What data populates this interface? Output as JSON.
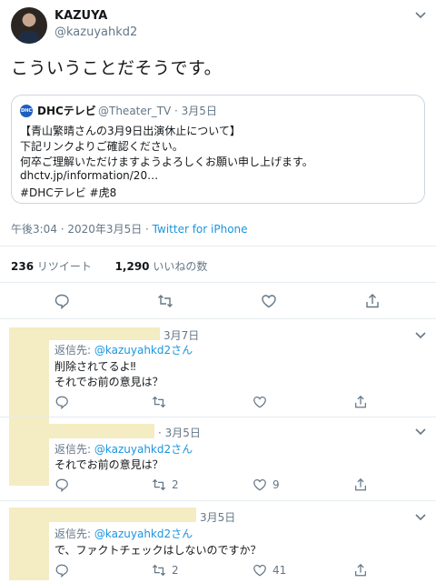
{
  "tweet": {
    "author_name": "KAZUYA",
    "author_handle": "@kazuyahkd2",
    "text": "こういうことだそうです。",
    "quoted": {
      "logo_text": "DHC",
      "name": "DHCテレビ",
      "handle_date": "@Theater_TV · 3月5日",
      "lines": [
        "【青山繁晴さんの3月9日出演休止について】",
        "下記リンクよりご確認ください。",
        "何卒ご理解いただけますようよろしくお願い申し上げます。",
        "dhctv.jp/information/20…",
        "#DHCテレビ #虎8"
      ]
    },
    "timestamp": "午後3:04 · 2020年3月5日 ·",
    "source": "Twitter for iPhone",
    "retweets_count": "236",
    "retweets_label": "リツイート",
    "likes_count": "1,290",
    "likes_label": "いいねの数"
  },
  "replies": [
    {
      "date": "3月7日",
      "reply_prefix": "返信先:",
      "reply_handle": "@kazuyahkd2さん",
      "lines": [
        "削除されてるよ‼",
        "それでお前の意見は？"
      ],
      "retweets": "",
      "likes": ""
    },
    {
      "date": "· 3月5日",
      "reply_prefix": "返信先:",
      "reply_handle": "@kazuyahkd2さん",
      "lines": [
        "それでお前の意見は？"
      ],
      "retweets": "2",
      "likes": "9"
    },
    {
      "date": "3月5日",
      "reply_prefix": "返信先:",
      "reply_handle": "@kazuyahkd2さん",
      "lines": [
        "で、ファクトチェックはしないのですか？"
      ],
      "retweets": "2",
      "likes": "41"
    }
  ],
  "colors": {
    "link": "#1b95e0",
    "muted": "#657786",
    "border": "#e6ecf0",
    "censor": "#f4ecc2",
    "heart_red": "#e0245e"
  }
}
